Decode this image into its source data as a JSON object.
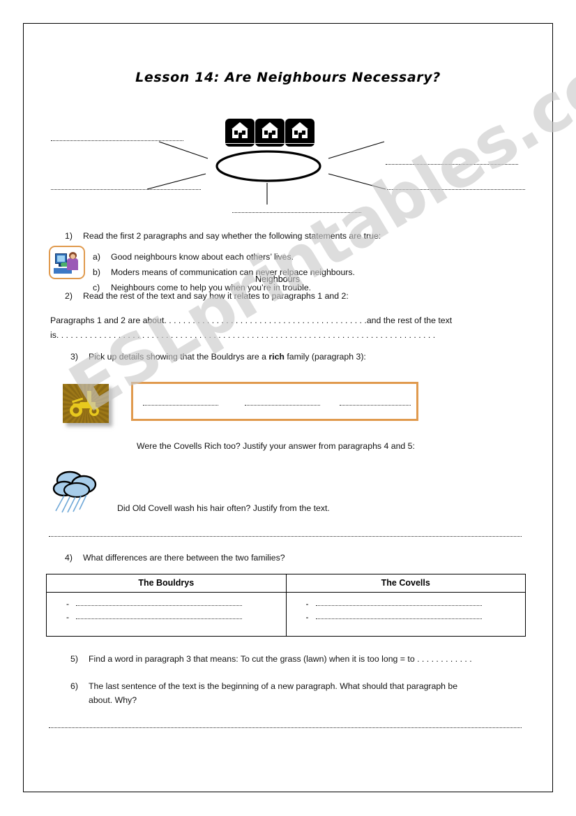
{
  "document": {
    "title": "Lesson 14: Are Neighbours Necessary?",
    "watermark": "ESLprintables.com"
  },
  "mindmap": {
    "center_label": "Neighbours",
    "house_icon_count": 3,
    "branch_count": 5,
    "branches": [
      {
        "id": "top-left",
        "blank": "...................................."
      },
      {
        "id": "bottom-left",
        "blank": "...................................."
      },
      {
        "id": "top-right",
        "blank": "...................................."
      },
      {
        "id": "bottom-right",
        "blank": "...................................."
      },
      {
        "id": "bottom",
        "blank": "...................................."
      }
    ]
  },
  "questions": {
    "q1": {
      "number": "1)",
      "text": "Read the first 2 paragraphs and say whether the following statements are true:",
      "items": [
        {
          "label": "a)",
          "text": "Good neighbours know about each others’ lives."
        },
        {
          "label": "b)",
          "text": "Moders means of communication can never relpace neighbours."
        },
        {
          "label": "c)",
          "text": "Neighbours come to help you when you’re in trouble."
        }
      ]
    },
    "q2": {
      "number": "2)",
      "text": "Read the rest of the text and say how it relates to paragraphs 1 and 2:",
      "fill_prefix": "Paragraphs 1 and 2 are about",
      "fill_dots_1": ". . . . . . . . . . . . . . . . . . . . . . . . . . . . . . . . . . . . . . . . . . .",
      "fill_middle": "and the rest of the text",
      "fill_prefix_2": "is",
      "fill_dots_2": ". . . . . . . . . . . . . . . . . . . . . . . . . . . . . . . . . . . . . . . . . . . . . . . . . . . . . . . . . . . . . . . . . . . . . . . . . . . . . . . ."
    },
    "q3": {
      "number": "3)",
      "text_before": "Pick up details showing that the Bouldrys are a",
      "bold_word": "rich",
      "text_after": "family (paragraph 3):"
    },
    "q4a": {
      "number": "4)",
      "text": "Were the Covells Rich too? Justify your answer from paragraphs  4 and 5:"
    },
    "q4b": {
      "text": "Did Old Covell wash his hair often? Justify from the text."
    },
    "q4c": {
      "number": "4)",
      "text": "What differences are there between the two families?"
    },
    "q5": {
      "number": "5)",
      "text": "Find a word in paragraph 3 that means: To cut the grass (lawn) when it is too long = to . . . . . . . . . . . ."
    },
    "q6": {
      "number": "6)",
      "text_line1": "The last sentence of the text is the beginning of a new paragraph. What should that paragraph be",
      "text_line2": "about. Why?"
    }
  },
  "answer_box": {
    "segments": [
      "...............",
      "...............",
      "..............."
    ]
  },
  "table": {
    "headers": [
      "The Bouldrys",
      "The Covells"
    ],
    "rows": [
      {
        "bouldrys": "-",
        "covells": "-"
      },
      {
        "bouldrys": "-",
        "covells": "-"
      }
    ],
    "bullet_dash": "-"
  },
  "icons": {
    "computer": "person-at-computer-icon",
    "tractor": "tractor-icon",
    "cloud": "rain-cloud-icon",
    "houses": "row-of-houses-icon"
  },
  "colors": {
    "accent_orange": "#E09A4E",
    "tractor_gold": "#E8C91E",
    "tractor_bg": "#8B6914",
    "cloud_blue": "#A8CDEA",
    "watermark_gray": "#c9c9c9",
    "ink": "#000000"
  }
}
